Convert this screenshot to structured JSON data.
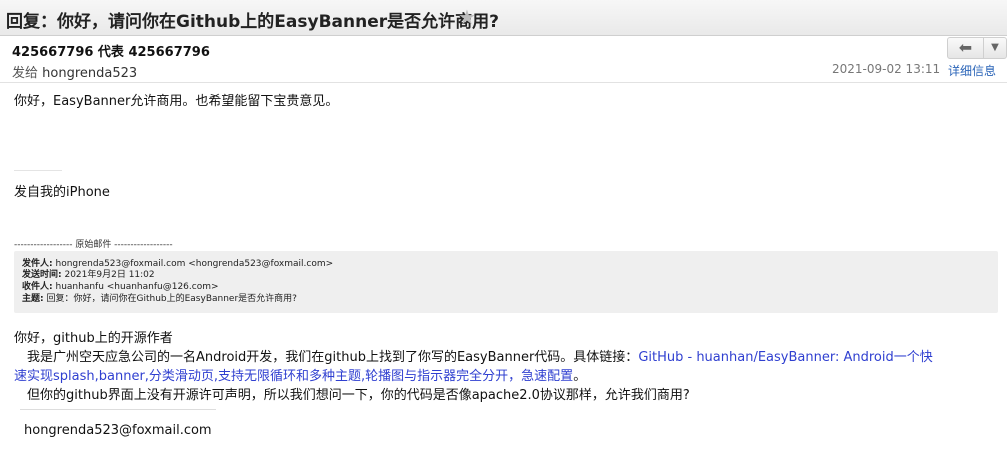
{
  "title_bar": {
    "subject": "回复：你好，请问你在Github上的EasyBanner是否允许商用?",
    "star_icon": "star-icon"
  },
  "header": {
    "sender": "425667796 代表 425667796",
    "to_prefix": "发给",
    "to_name": "hongrenda523",
    "date": "2021-09-02 13:11",
    "details_link": "详细信息",
    "reply_icon": "reply-arrow-icon",
    "more_icon": "chevron-down-icon"
  },
  "body": {
    "reply_line": "你好，EasyBanner允许商用。也希望能留下宝贵意见。",
    "sent_from": "发自我的iPhone",
    "original_separator": "------------------ 原始邮件 ------------------"
  },
  "quote": {
    "from_label": "发件人:",
    "from_value": "hongrenda523@foxmail.com <hongrenda523@foxmail.com>",
    "sent_label": "发送时间:",
    "sent_value": "2021年9月2日 11:02",
    "to_label": "收件人:",
    "to_value": "huanhanfu <huanhanfu@126.com>",
    "subject_label": "主题:",
    "subject_value": "回复：你好，请问你在Github上的EasyBanner是否允许商用?"
  },
  "original": {
    "greeting": "你好，github上的开源作者",
    "line1_text": "　我是广州空天应急公司的一名Android开发，我们在github上找到了你写的EasyBanner代码。具体链接：",
    "link_part1": "GitHub - huanhan/EasyBanner: Android一个快",
    "link_part2": "速实现splash,banner,分类滑动页,支持无限循环和多种主题,轮播图与指示器完全分开，急速配置",
    "link_end": "。",
    "line3": "　但你的github界面上没有开源许可声明，所以我们想问一下，你的代码是否像apache2.0协议那样，允许我们商用?",
    "signature": "hongrenda523@foxmail.com"
  },
  "colors": {
    "link": "#2f3fd0",
    "details": "#2a64b8",
    "quote_bg": "#efefef"
  }
}
